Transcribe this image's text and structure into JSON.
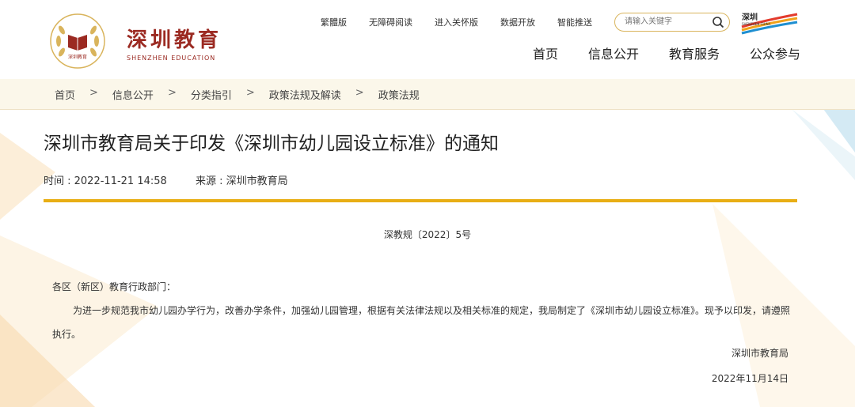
{
  "header": {
    "brand_cn": "深圳教育",
    "brand_en": "SHENZHEN EDUCATION",
    "logo_text": "深圳教育",
    "util_links": [
      "繁體版",
      "无障碍阅读",
      "进入关怀版",
      "数据开放",
      "智能推送"
    ],
    "search_placeholder": "请输入关键字",
    "sz_logo_text": "深圳",
    "sz_logo_en": "SHENZHEN CHINA",
    "nav": [
      "首页",
      "信息公开",
      "教育服务",
      "公众参与"
    ]
  },
  "breadcrumb": [
    "首页",
    "信息公开",
    "分类指引",
    "政策法规及解读",
    "政策法规"
  ],
  "breadcrumb_sep": ">",
  "article": {
    "title": "深圳市教育局关于印发《深圳市幼儿园设立标准》的通知",
    "time": "时间 : 2022-11-21 14:58",
    "source": "来源 : 深圳市教育局",
    "doc_number": "深教规〔2022〕5号",
    "salutation": "各区（新区）教育行政部门：",
    "paragraph": "为进一步规范我市幼儿园办学行为，改善办学条件，加强幼儿园管理，根据有关法律法规以及相关标准的规定，我局制定了《深圳市幼儿园设立标准》。现予以印发，请遵照执行。",
    "signer": "深圳市教育局",
    "date": "2022年11月14日"
  },
  "colors": {
    "accent_gold": "#e8ae14",
    "brand_red": "#9b2a22",
    "crumb_bg": "#fbf7ea"
  },
  "icons": [
    "search-icon",
    "book-logo-icon"
  ]
}
